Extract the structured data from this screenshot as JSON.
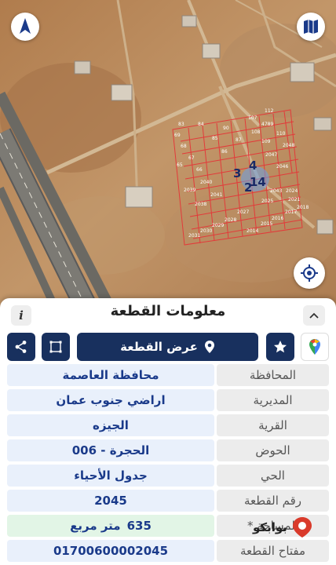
{
  "map": {
    "parcels": [
      {
        "n": "112"
      },
      {
        "n": "107"
      },
      {
        "n": "4789"
      },
      {
        "n": "110"
      },
      {
        "n": "109"
      },
      {
        "n": "2048"
      },
      {
        "n": "2047"
      },
      {
        "n": "2046"
      },
      {
        "n": "2043"
      },
      {
        "n": "2024"
      },
      {
        "n": "2021"
      },
      {
        "n": "2025"
      },
      {
        "n": "2017"
      },
      {
        "n": "2018"
      },
      {
        "n": "2016"
      },
      {
        "n": "2015"
      },
      {
        "n": "2014"
      },
      {
        "n": "2027"
      },
      {
        "n": "2028"
      },
      {
        "n": "2029"
      },
      {
        "n": "2030"
      },
      {
        "n": "2031"
      },
      {
        "n": "2038"
      },
      {
        "n": "2039"
      },
      {
        "n": "2040"
      },
      {
        "n": "2041"
      },
      {
        "n": "84"
      },
      {
        "n": "90"
      },
      {
        "n": "83"
      },
      {
        "n": "69"
      },
      {
        "n": "68"
      },
      {
        "n": "67"
      },
      {
        "n": "66"
      },
      {
        "n": "65"
      },
      {
        "n": "85"
      },
      {
        "n": "86"
      },
      {
        "n": "87"
      },
      {
        "n": "108"
      }
    ],
    "highlight_labels": [
      {
        "n": "3"
      },
      {
        "n": "4"
      },
      {
        "n": "14"
      },
      {
        "n": "2"
      }
    ]
  },
  "buttons": {
    "compass_icon": "navigation-arrow-icon",
    "maps_icon": "map-folded-icon",
    "locate_icon": "gps-target-icon"
  },
  "panel": {
    "title": "معلومات القطعة",
    "show_parcel_label": "عرض القطعة",
    "rows": [
      {
        "label": "المحافظة",
        "value": "محافظة العاصمة"
      },
      {
        "label": "المديرية",
        "value": "اراضي جنوب عمان"
      },
      {
        "label": "القرية",
        "value": "الجيزه"
      },
      {
        "label": "الحوض",
        "value": "الحجرة - 006"
      },
      {
        "label": "الحي",
        "value": "جدول الأحياء"
      },
      {
        "label": "رقم القطعة",
        "value": "2045"
      },
      {
        "label": "المساحة *",
        "value": "635",
        "unit": "متر مربع"
      },
      {
        "label": "مفتاح القطعة",
        "value": "01700600002045"
      }
    ]
  },
  "watermark": {
    "text": "بوابكو"
  },
  "colors": {
    "navy": "#18305e",
    "value_text": "#1a3a8a",
    "parcel_line": "#e23a3a",
    "label_bg": "#ececec",
    "value_bg": "#e9f0fb",
    "highlight_bg": "#e2f5e6"
  }
}
